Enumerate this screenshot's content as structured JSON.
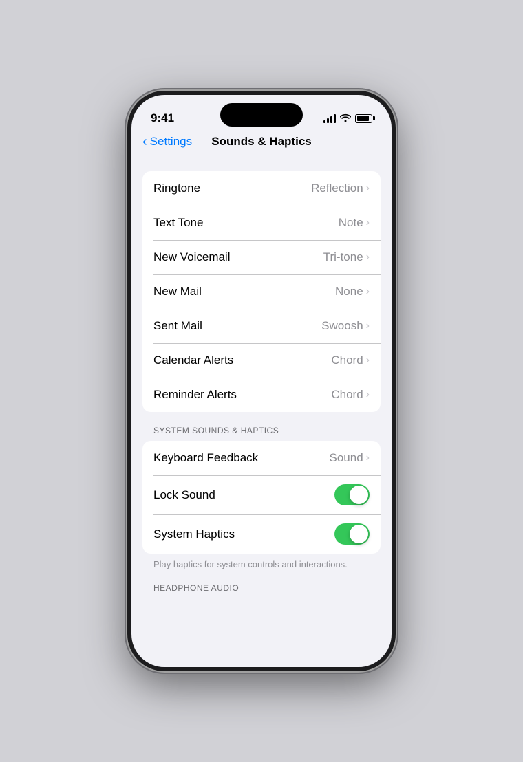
{
  "status": {
    "time": "9:41",
    "signal_bars": 4,
    "wifi": true,
    "battery_percent": 85
  },
  "nav": {
    "back_label": "Settings",
    "title": "Sounds & Haptics"
  },
  "tones_section": {
    "items": [
      {
        "label": "Ringtone",
        "value": "Reflection"
      },
      {
        "label": "Text Tone",
        "value": "Note"
      },
      {
        "label": "New Voicemail",
        "value": "Tri-tone"
      },
      {
        "label": "New Mail",
        "value": "None"
      },
      {
        "label": "Sent Mail",
        "value": "Swoosh"
      },
      {
        "label": "Calendar Alerts",
        "value": "Chord"
      },
      {
        "label": "Reminder Alerts",
        "value": "Chord"
      }
    ]
  },
  "system_sounds_section": {
    "header": "SYSTEM SOUNDS & HAPTICS",
    "items": [
      {
        "label": "Keyboard Feedback",
        "value": "Sound",
        "type": "nav"
      },
      {
        "label": "Lock Sound",
        "type": "toggle",
        "on": true
      },
      {
        "label": "System Haptics",
        "type": "toggle",
        "on": true
      }
    ],
    "note": "Play haptics for system controls and interactions."
  },
  "headphone_section": {
    "header": "HEADPHONE AUDIO"
  }
}
